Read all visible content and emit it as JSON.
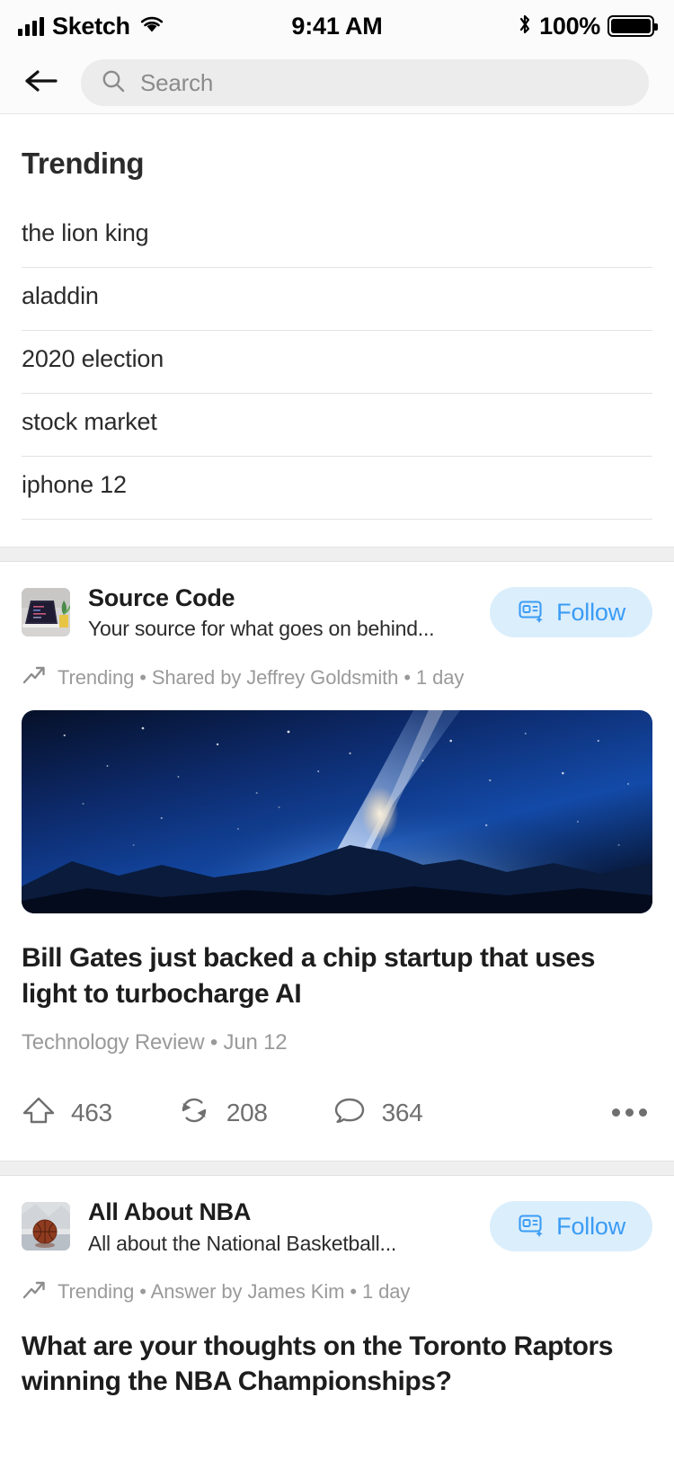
{
  "status_bar": {
    "carrier": "Sketch",
    "time": "9:41 AM",
    "battery_percent": "100%",
    "signal_icon": "signal-bars-icon",
    "wifi_icon": "wifi-icon",
    "bluetooth_icon": "bluetooth-icon",
    "battery_icon": "battery-full-icon"
  },
  "header": {
    "back_icon": "back-arrow-icon",
    "search_icon": "search-icon",
    "search_value": "",
    "search_placeholder": "Search"
  },
  "trending": {
    "title": "Trending",
    "items": [
      {
        "label": "the lion king"
      },
      {
        "label": "aladdin"
      },
      {
        "label": "2020 election"
      },
      {
        "label": "stock market"
      },
      {
        "label": "iphone 12"
      }
    ]
  },
  "feed": [
    {
      "publication": "Source Code",
      "description": "Your source for what goes on behind...",
      "follow_label": "Follow",
      "follow_icon": "news-card-add-icon",
      "avatar_icon": "laptop-photo-avatar",
      "context_icon": "trending-arrow-icon",
      "context": "Trending • Shared by Jeffrey Goldsmith • 1 day",
      "hero_image": "milky-way-night-sky-photo",
      "title": "Bill Gates just backed a chip startup that uses light to turbocharge AI",
      "source": "Technology Review • Jun 12",
      "actions": {
        "upvote_icon": "upvote-arrow-icon",
        "upvote_count": "463",
        "repost_icon": "repost-icon",
        "repost_count": "208",
        "comment_icon": "comment-bubble-icon",
        "comment_count": "364",
        "more_icon": "more-options-icon"
      }
    },
    {
      "publication": "All About NBA",
      "description": "All about the National Basketball...",
      "follow_label": "Follow",
      "follow_icon": "news-card-add-icon",
      "avatar_icon": "basketball-photo-avatar",
      "context_icon": "trending-arrow-icon",
      "context": "Trending • Answer by James Kim • 1 day",
      "title": "What are your thoughts on the Toronto Raptors winning the NBA Championships?"
    }
  ],
  "colors": {
    "accent_blue": "#3a9cf5",
    "follow_bg": "#dbeefc",
    "text_primary": "#1d1d1d",
    "text_muted": "#9a9a9a",
    "separator": "#e3e3e3",
    "section_gap": "#efefef"
  }
}
